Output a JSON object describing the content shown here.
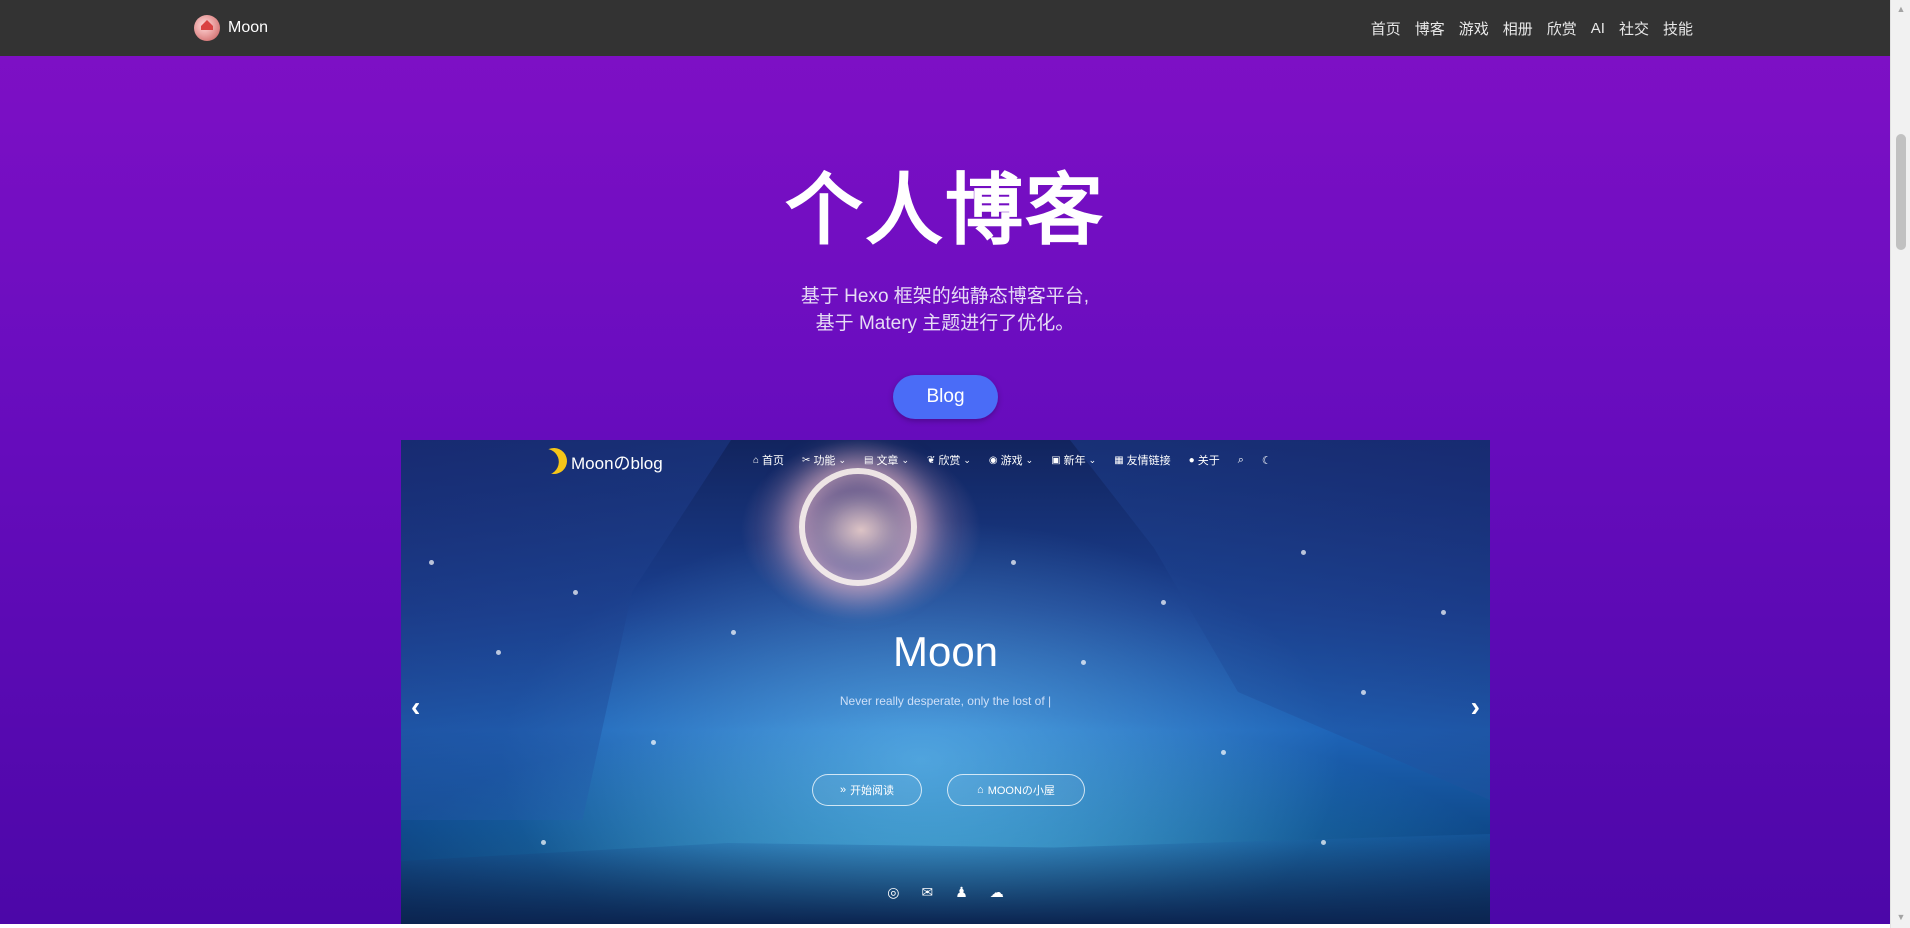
{
  "navbar": {
    "brand_name": "Moon",
    "links": [
      "首页",
      "博客",
      "游戏",
      "相册",
      "欣赏",
      "AI",
      "社交",
      "技能"
    ]
  },
  "hero": {
    "title": "个人博客",
    "subtitle_line1": "基于 Hexo 框架的纯静态博客平台,",
    "subtitle_line2": "基于 Matery 主题进行了优化。",
    "button_label": "Blog"
  },
  "preview": {
    "brand_name": "Moonのblog",
    "menu": {
      "home": "首页",
      "features": "功能",
      "articles": "文章",
      "appreciate": "欣赏",
      "games": "游戏",
      "new_year": "新年",
      "friends": "友情链接",
      "about": "关于"
    },
    "title": "Moon",
    "subtitle": "Never really desperate, only the lost of |",
    "button_read": "开始阅读",
    "button_home": "MOONの小屋"
  },
  "colors": {
    "topbar": "#333333",
    "hero_gradient_top": "#8110c6",
    "hero_gradient_bottom": "#4c07a8",
    "blog_button": "#4a6cf7"
  }
}
